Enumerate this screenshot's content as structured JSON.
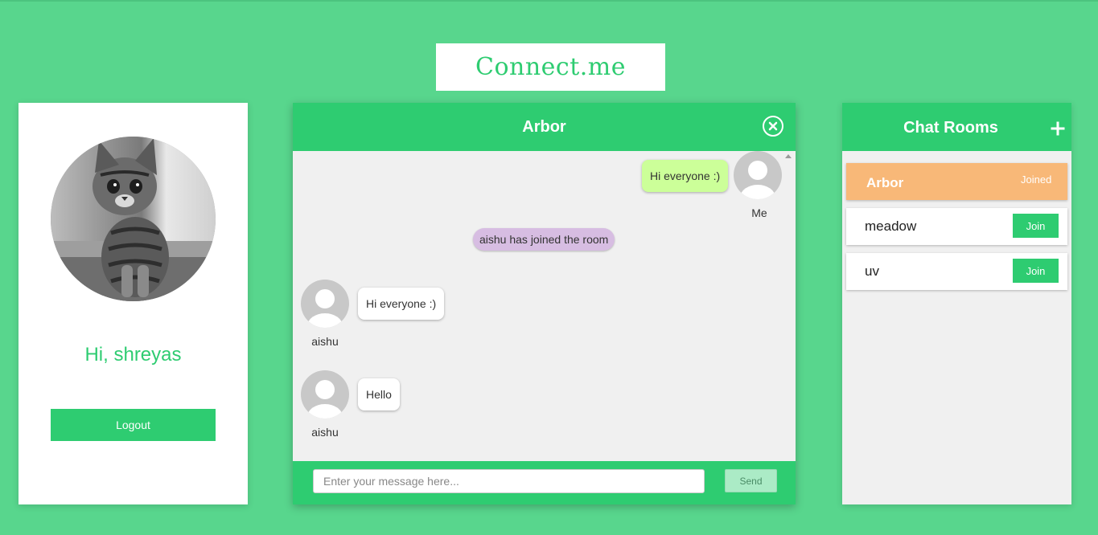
{
  "app": {
    "logo": "Connect.me"
  },
  "profile": {
    "greeting": "Hi, shreyas",
    "logout_label": "Logout",
    "avatar_icon": "kitten-photo"
  },
  "chat": {
    "room_title": "Arbor",
    "close_icon": "close-circle-icon",
    "messages": [
      {
        "sender": "Me",
        "text": "Hi everyone :)",
        "type": "outgoing"
      },
      {
        "text": "aishu has joined the room",
        "type": "system"
      },
      {
        "sender": "aishu",
        "text": "Hi everyone :)",
        "type": "incoming"
      },
      {
        "sender": "aishu",
        "text": "Hello",
        "type": "incoming"
      }
    ],
    "input": {
      "placeholder": "Enter your message here...",
      "value": ""
    },
    "send_label": "Send"
  },
  "rooms": {
    "title": "Chat Rooms",
    "add_icon": "plus-icon",
    "items": [
      {
        "name": "Arbor",
        "status": "Joined"
      },
      {
        "name": "meadow",
        "action": "Join"
      },
      {
        "name": "uv",
        "action": "Join"
      }
    ]
  },
  "colors": {
    "background": "#58d68d",
    "accent": "#2ecc71",
    "active_room": "#f8b878",
    "outgoing_bubble": "#ccff99",
    "system_bubble": "#d7bde2"
  }
}
